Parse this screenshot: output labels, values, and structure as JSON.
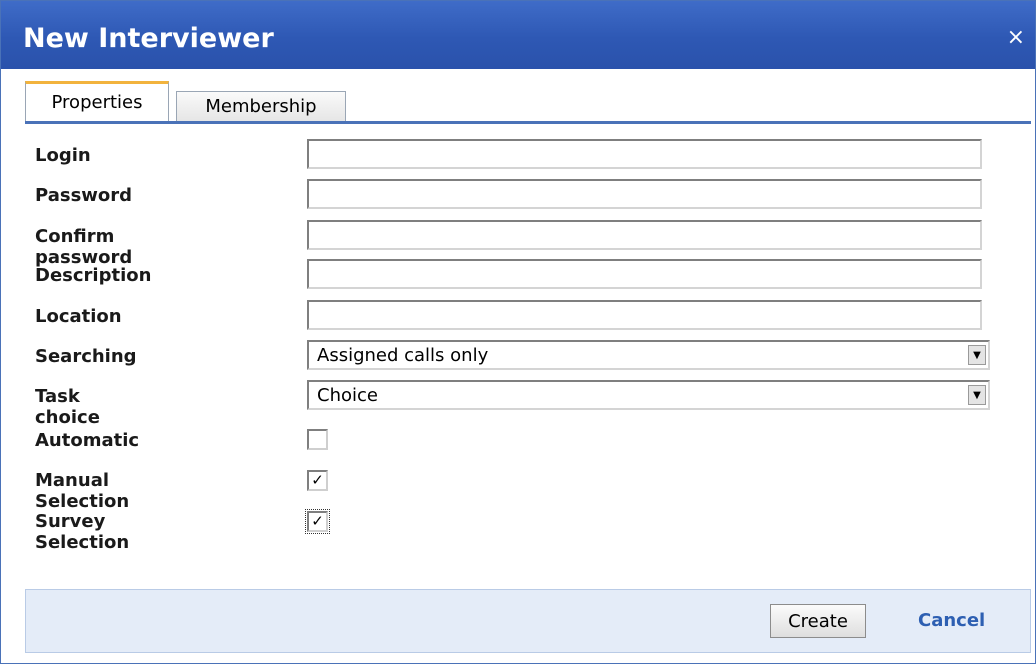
{
  "dialog": {
    "title": "New Interviewer",
    "close_glyph": "×"
  },
  "tabs": [
    {
      "label": "Properties",
      "active": true
    },
    {
      "label": "Membership",
      "active": false
    }
  ],
  "fields": {
    "login": {
      "label": "Login",
      "value": ""
    },
    "password": {
      "label": "Password",
      "value": ""
    },
    "confirm_password": {
      "label": "Confirm password",
      "value": ""
    },
    "description": {
      "label": "Description",
      "value": ""
    },
    "location": {
      "label": "Location",
      "value": ""
    },
    "searching": {
      "label": "Searching",
      "value": "Assigned calls only"
    },
    "task_choice": {
      "label": "Task choice",
      "value": "Choice"
    },
    "automatic": {
      "label": "Automatic",
      "checked": false
    },
    "manual_selection": {
      "label": "Manual Selection",
      "checked": true
    },
    "survey_selection": {
      "label": "Survey Selection",
      "checked": true
    }
  },
  "footer": {
    "create_label": "Create",
    "cancel_label": "Cancel"
  },
  "colors": {
    "title_bar": "#2e58b4",
    "accent": "#4a72b8",
    "tab_highlight": "#f2b33d",
    "footer_bg": "#e4ecf8",
    "link": "#2d5fb2"
  },
  "icons": {
    "close": "close-icon",
    "dropdown": "chevron-down-icon",
    "check": "checkmark-icon"
  }
}
